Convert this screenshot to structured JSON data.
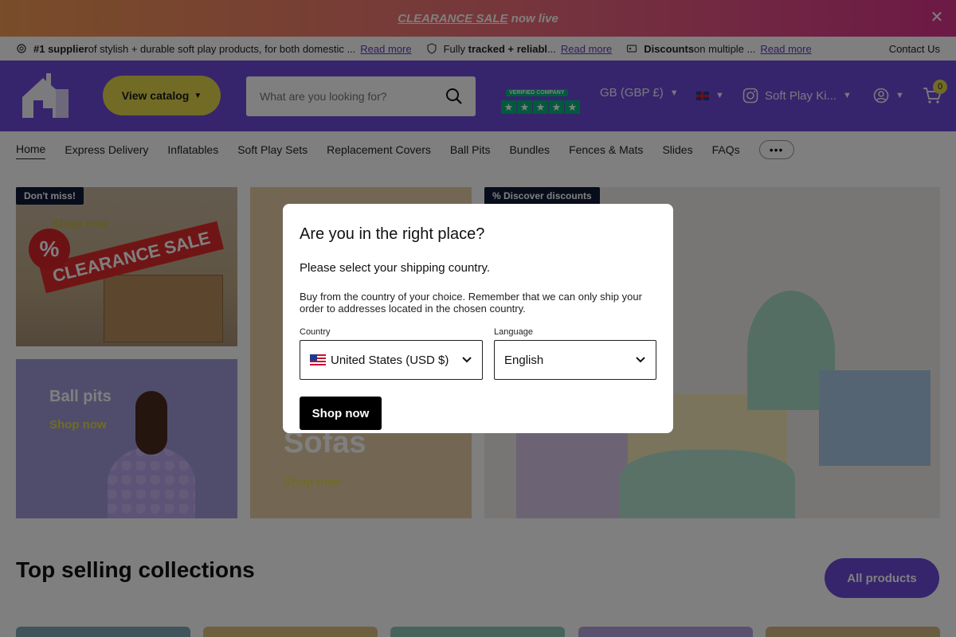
{
  "announcement": {
    "link_text": "CLEARANCE SALE",
    "suffix": " now live"
  },
  "usp": [
    {
      "bold": "#1 supplier",
      "text": " of stylish + durable soft play products, for both domestic ...",
      "link": "Read more"
    },
    {
      "prefix": "Fully ",
      "bold": "tracked + reliabl",
      "text": "...",
      "link": "Read more"
    },
    {
      "bold": "Discounts",
      "text": " on multiple ...",
      "link": "Read more"
    }
  ],
  "contact": "Contact Us",
  "header": {
    "catalog_label": "View catalog",
    "search_placeholder": "What are you looking for?",
    "trust_badge": "VERIFIED COMPANY",
    "currency": "GB (GBP £)",
    "store_name": "Soft Play Ki...",
    "cart_count": "0"
  },
  "nav": [
    "Home",
    "Express Delivery",
    "Inflatables",
    "Soft Play Sets",
    "Replacement Covers",
    "Ball Pits",
    "Bundles",
    "Fences & Mats",
    "Slides",
    "FAQs"
  ],
  "nav_more": "•••",
  "tiles": {
    "sale": {
      "tag": "Don't miss!",
      "shop": "Shop now",
      "sign": "CLEARANCE SALE",
      "percent": "%"
    },
    "ballpits": {
      "title": "Ball pits",
      "shop": "Shop now"
    },
    "sofas": {
      "title": "Sofas",
      "shop": "Shop now"
    },
    "discounts": {
      "tag": "% Discover discounts"
    }
  },
  "section": {
    "title": "Top selling collections",
    "button": "All products"
  },
  "modal": {
    "title": "Are you in the right place?",
    "subtitle": "Please select your shipping country.",
    "description": "Buy from the country of your choice. Remember that we can only ship your order to addresses located in the chosen country.",
    "country_label": "Country",
    "country_value": "United States (USD $)",
    "language_label": "Language",
    "language_value": "English",
    "submit": "Shop now"
  }
}
